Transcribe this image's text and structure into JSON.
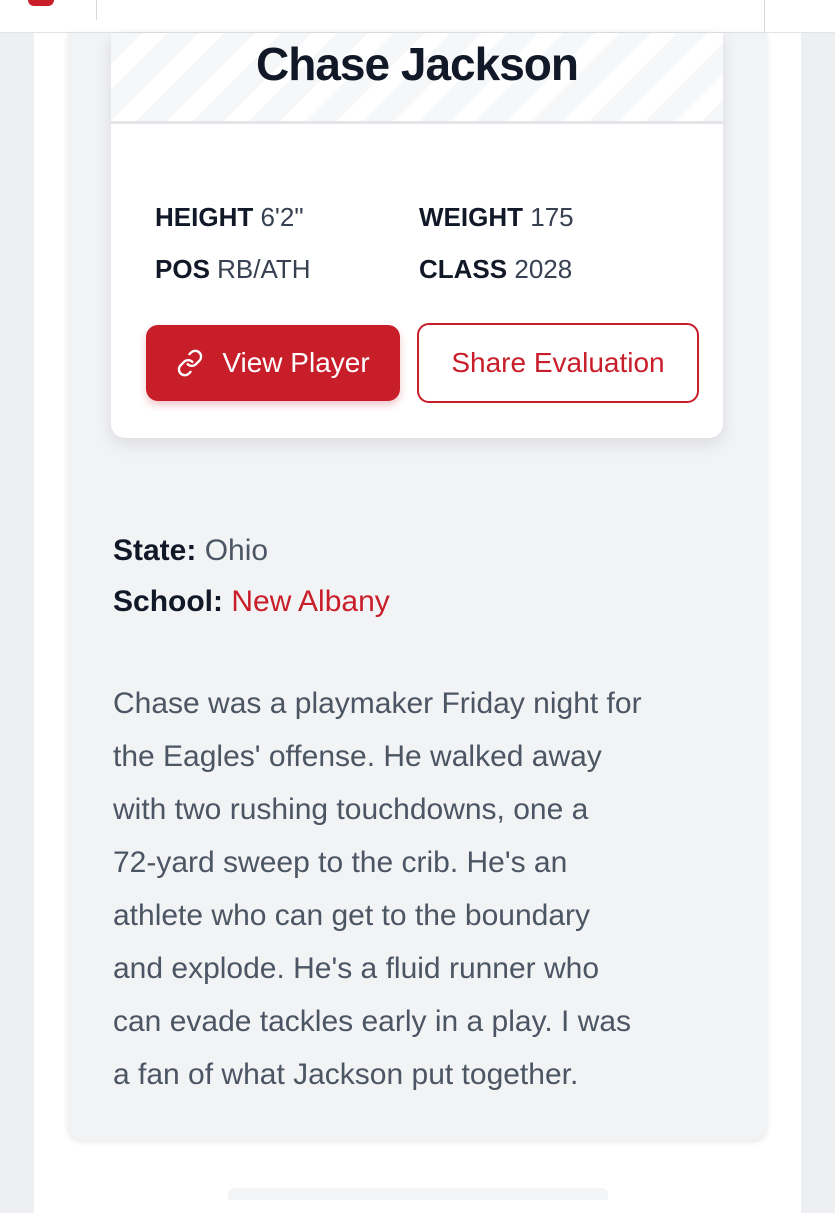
{
  "player": {
    "name": "Chase Jackson",
    "height_label": "HEIGHT",
    "height_value": "6'2\"",
    "weight_label": "WEIGHT",
    "weight_value": "175",
    "pos_label": "POS",
    "pos_value": "RB/ATH",
    "class_label": "CLASS",
    "class_value": "2028",
    "view_button": "View Player",
    "share_button": "Share Evaluation",
    "view_icon": "link-icon"
  },
  "evaluation": {
    "state_label": "State:",
    "state_value": "Ohio",
    "school_label": "School:",
    "school_value": "New Albany",
    "description_lines": [
      "Chase was a playmaker Friday night for",
      "the Eagles' offense. He walked away",
      "with two rushing touchdowns, one a",
      "72-yard sweep to the crib. He's an",
      "athlete who can get to the boundary",
      "and explode. He's a fluid runner who",
      "can evade tackles early in a play. I was",
      "a fan of what Jackson put together."
    ]
  },
  "colors": {
    "accent": "#c81e2a",
    "page_bg": "#eeeff2",
    "card_bg": "#f2f3f5",
    "text_dark": "#111827",
    "text_muted": "#4b5563"
  }
}
